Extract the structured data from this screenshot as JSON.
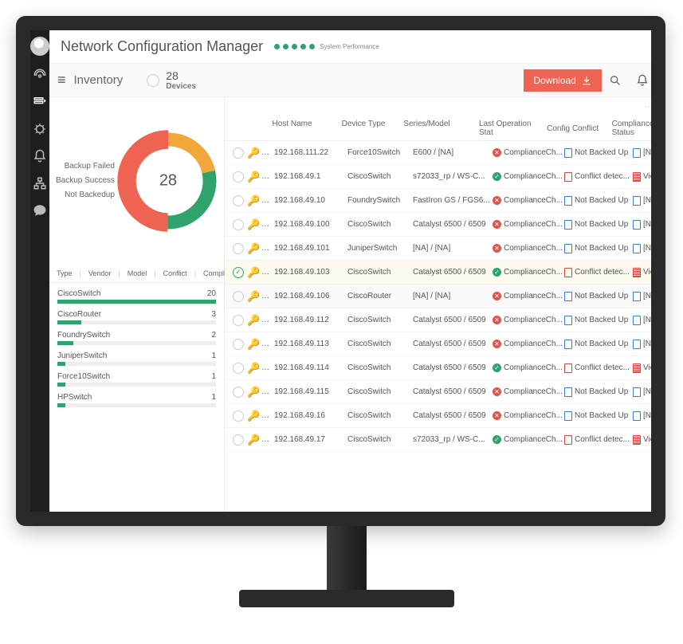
{
  "app": {
    "title": "Network Configuration Manager",
    "sys_perf_label": "System Performance"
  },
  "subbar": {
    "crumb": "Inventory",
    "count": "28",
    "count_label": "Devices",
    "download": "Download"
  },
  "chart_data": {
    "type": "pie",
    "title": "",
    "center_value": 28,
    "series": [
      {
        "name": "Backup Failed",
        "value": 14,
        "color": "#ee6352"
      },
      {
        "name": "Backup Success",
        "value": 8,
        "color": "#2fa36b"
      },
      {
        "name": "Not Backedup",
        "value": 6,
        "color": "#f3a73b"
      }
    ]
  },
  "tabs": [
    "Type",
    "Vendor",
    "Model",
    "Conflict",
    "Compliance"
  ],
  "type_breakdown": {
    "max": 20,
    "items": [
      {
        "label": "CiscoSwitch",
        "value": 20
      },
      {
        "label": "CiscoRouter",
        "value": 3
      },
      {
        "label": "FoundrySwitch",
        "value": 2
      },
      {
        "label": "JuniperSwitch",
        "value": 1
      },
      {
        "label": "Force10Switch",
        "value": 1
      },
      {
        "label": "HPSwitch",
        "value": 1
      }
    ]
  },
  "grid": {
    "columns": [
      "Host Name",
      "Device Type",
      "Series/Model",
      "Last Operation Stat",
      "Config Conflict",
      "Compliance Status"
    ],
    "rows": [
      {
        "selected": false,
        "host": "192.168.111.22",
        "type": "Force10Switch",
        "series": "E600 / [NA]",
        "op_ok": false,
        "op_text": "ComplianceCh...",
        "conflict_icon": "blue",
        "conflict_text": "Not Backed Up",
        "compl_icon": "blue",
        "compl_text": "[NA]"
      },
      {
        "selected": false,
        "host": "192.168.49.1",
        "type": "CiscoSwitch",
        "series": "s72033_rp / WS-C...",
        "op_ok": true,
        "op_text": "ComplianceCh...",
        "conflict_icon": "red",
        "conflict_text": "Conflict detec...",
        "compl_icon": "red2",
        "compl_text": "Violation"
      },
      {
        "selected": false,
        "host": "192.168.49.10",
        "type": "FoundrySwitch",
        "series": "FastIron GS / FGS6...",
        "op_ok": false,
        "op_text": "ComplianceCh...",
        "conflict_icon": "blue",
        "conflict_text": "Not Backed Up",
        "compl_icon": "blue",
        "compl_text": "[NA]"
      },
      {
        "selected": false,
        "host": "192.168.49.100",
        "type": "CiscoSwitch",
        "series": "Catalyst 6500 / 6509",
        "op_ok": false,
        "op_text": "ComplianceCh...",
        "conflict_icon": "blue",
        "conflict_text": "Not Backed Up",
        "compl_icon": "blue",
        "compl_text": "[NA]"
      },
      {
        "selected": false,
        "host": "192.168.49.101",
        "type": "JuniperSwitch",
        "series": "[NA] / [NA]",
        "op_ok": false,
        "op_text": "ComplianceCh...",
        "conflict_icon": "blue",
        "conflict_text": "Not Backed Up",
        "compl_icon": "blue",
        "compl_text": "[NA]"
      },
      {
        "selected": true,
        "host": "192.168.49.103",
        "type": "CiscoSwitch",
        "series": "Catalyst 6500 / 6509",
        "op_ok": true,
        "op_text": "ComplianceCh...",
        "conflict_icon": "red",
        "conflict_text": "Conflict detec...",
        "compl_icon": "red2",
        "compl_text": "Violation"
      },
      {
        "selected": false,
        "hover": true,
        "host": "192.168.49.106",
        "type": "CiscoRouter",
        "series": "[NA] / [NA]",
        "op_ok": false,
        "op_text": "ComplianceCh...",
        "conflict_icon": "blue",
        "conflict_text": "Not Backed Up",
        "compl_icon": "blue",
        "compl_text": "[NA]"
      },
      {
        "selected": false,
        "host": "192.168.49.112",
        "type": "CiscoSwitch",
        "series": "Catalyst 6500 / 6509",
        "op_ok": false,
        "op_text": "ComplianceCh...",
        "conflict_icon": "blue",
        "conflict_text": "Not Backed Up",
        "compl_icon": "blue",
        "compl_text": "[NA]"
      },
      {
        "selected": false,
        "host": "192.168.49.113",
        "type": "CiscoSwitch",
        "series": "Catalyst 6500 / 6509",
        "op_ok": false,
        "op_text": "ComplianceCh...",
        "conflict_icon": "blue",
        "conflict_text": "Not Backed Up",
        "compl_icon": "blue",
        "compl_text": "[NA]"
      },
      {
        "selected": false,
        "host": "192.168.49.114",
        "type": "CiscoSwitch",
        "series": "Catalyst 6500 / 6509",
        "op_ok": true,
        "op_text": "ComplianceCh...",
        "conflict_icon": "red",
        "conflict_text": "Conflict detec...",
        "compl_icon": "red2",
        "compl_text": "Violation"
      },
      {
        "selected": false,
        "host": "192.168.49.115",
        "type": "CiscoSwitch",
        "series": "Catalyst 6500 / 6509",
        "op_ok": false,
        "op_text": "ComplianceCh...",
        "conflict_icon": "blue",
        "conflict_text": "Not Backed Up",
        "compl_icon": "blue",
        "compl_text": "[NA]"
      },
      {
        "selected": false,
        "host": "192.168.49.16",
        "type": "CiscoSwitch",
        "series": "Catalyst 6500 / 6509",
        "op_ok": false,
        "op_text": "ComplianceCh...",
        "conflict_icon": "blue",
        "conflict_text": "Not Backed Up",
        "compl_icon": "blue",
        "compl_text": "[NA]"
      },
      {
        "selected": false,
        "host": "192.168.49.17",
        "type": "CiscoSwitch",
        "series": "s72033_rp / WS-C...",
        "op_ok": true,
        "op_text": "ComplianceCh...",
        "conflict_icon": "red",
        "conflict_text": "Conflict detec...",
        "compl_icon": "red2",
        "compl_text": "Violation"
      }
    ]
  }
}
